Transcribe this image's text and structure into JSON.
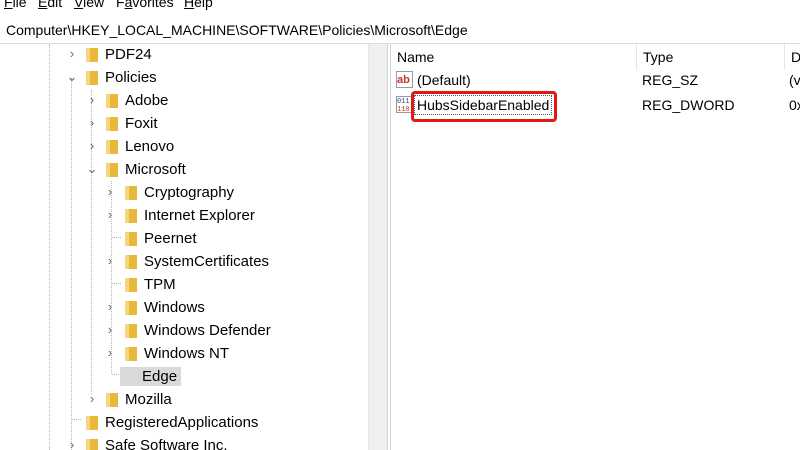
{
  "menu": {
    "file": {
      "u": "F",
      "rest": "ile"
    },
    "edit": {
      "u": "E",
      "rest": "dit"
    },
    "view": {
      "u": "V",
      "rest": "iew"
    },
    "favorites": {
      "pre": "F",
      "u": "a",
      "rest": "vorites"
    },
    "help": {
      "u": "H",
      "rest": "elp"
    }
  },
  "address": "Computer\\HKEY_LOCAL_MACHINE\\SOFTWARE\\Policies\\Microsoft\\Edge",
  "tree": {
    "pdf24": "PDF24",
    "policies": "Policies",
    "adobe": "Adobe",
    "foxit": "Foxit",
    "lenovo": "Lenovo",
    "microsoft": "Microsoft",
    "cryptography": "Cryptography",
    "internet_explorer": "Internet Explorer",
    "peernet": "Peernet",
    "systemcertificates": "SystemCertificates",
    "tpm": "TPM",
    "windows": "Windows",
    "windows_defender": "Windows Defender",
    "windows_nt": "Windows NT",
    "edge": "Edge",
    "mozilla": "Mozilla",
    "registeredapplications": "RegisteredApplications",
    "safe_software": "Safe Software Inc."
  },
  "columns": {
    "name": "Name",
    "type": "Type",
    "data": "D"
  },
  "values": [
    {
      "name": "(Default)",
      "type": "REG_SZ",
      "data": "(v",
      "icon": "string-value-icon"
    },
    {
      "name": "HubsSidebarEnabled",
      "type": "REG_DWORD",
      "data": "0x",
      "icon": "dword-value-icon"
    }
  ],
  "colors": {
    "highlight": "#e01818",
    "folder": "#e8b83a",
    "selection": "#d9d9d9"
  }
}
